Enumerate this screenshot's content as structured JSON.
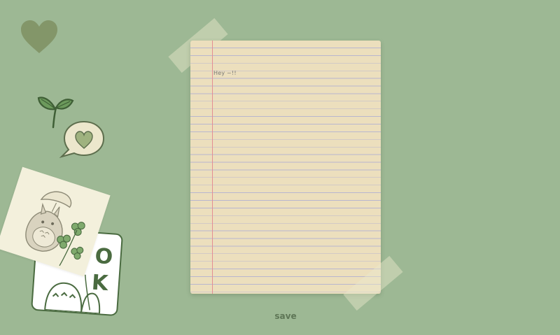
{
  "note": {
    "text": "Hey ~!!"
  },
  "actions": {
    "save_label": "save"
  },
  "stickers": {
    "ok_letters": [
      "O",
      "K"
    ]
  },
  "colors": {
    "background": "#9db894",
    "paper": "#ecdfbd",
    "paper_rule": "#b8b6cf",
    "paper_margin": "#e48e93",
    "sticker_green": "#4a6b40",
    "heart": "#7f8f62",
    "save_text": "#5e7656"
  },
  "icons": [
    "heart-icon",
    "sprout-icon",
    "speech-bubble-heart-icon",
    "totoro-sticker",
    "ok-sticker"
  ]
}
